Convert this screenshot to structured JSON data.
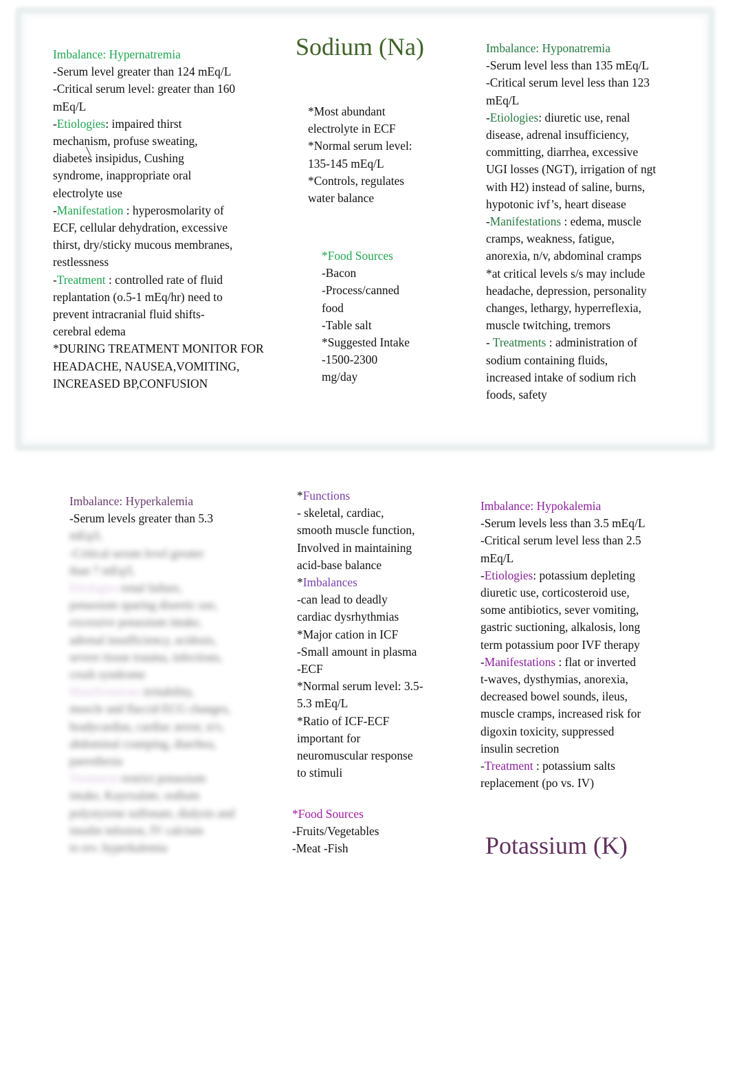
{
  "sodium": {
    "title": "Sodium (Na)",
    "hypernatremia": {
      "heading": "Imbalance: Hypernatremia",
      "lines": [
        "-Serum level greater than 124 mEq/L",
        "-Critical serum level: greater than 160",
        "mEq/L"
      ],
      "etiologies_label": "Etiologies",
      "etiologies_lines": [
        ": impaired thirst",
        "mechanism, profuse sweating,",
        "diabetes insipidus, Cushing",
        "syndrome, inappropriate oral",
        "electrolyte use"
      ],
      "manifestation_label": "Manifestation",
      "manifestation_lines": [
        " : hyperosmolarity of",
        "ECF, cellular dehydration, excessive",
        "thirst, dry/sticky mucous membranes,",
        "restlessness"
      ],
      "treatment_label": "Treatment",
      "treatment_lines": [
        " : controlled rate of fluid",
        "replantation (o.5-1 mEq/hr) need to",
        "prevent intracranial fluid shifts-",
        "cerebral edema",
        "*DURING TREATMENT MONITOR FOR",
        "HEADACHE, NAUSEA,VOMITING,",
        "INCREASED BP,CONFUSION"
      ]
    },
    "center": {
      "facts": [
        "*Most abundant",
        "electrolyte in ECF",
        "*Normal serum level:",
        "135-145 mEq/L",
        "*Controls, regulates",
        "water balance"
      ],
      "food_heading": "*Food Sources",
      "food_lines": [
        "-Bacon",
        "-Process/canned",
        "food",
        "-Table salt",
        "*Suggested Intake",
        "-1500-2300",
        "mg/day"
      ]
    },
    "hyponatremia": {
      "heading": "Imbalance: Hyponatremia",
      "lines": [
        "-Serum level less than 135 mEq/L",
        "-Critical serum level less than 123",
        "mEq/L"
      ],
      "etiologies_label": "Etiologies",
      "etiologies_lines": [
        ": diuretic use, renal",
        "disease, adrenal insufficiency,",
        "committing, diarrhea, excessive",
        "UGI losses (NGT), irrigation of ngt",
        "with H2) instead of saline, burns,",
        "hypotonic ivf’s, heart disease"
      ],
      "manifestations_label": "Manifestations",
      "manifestations_lines": [
        " : edema, muscle",
        "cramps, weakness, fatigue,",
        "anorexia, n/v, abdominal cramps",
        "*at critical levels s/s may include",
        "headache, depression, personality",
        "changes, lethargy, hyperreflexia,",
        "muscle twitching, tremors"
      ],
      "treatments_label": "Treatments",
      "treatments_lines": [
        " : administration of",
        "sodium containing fluids,",
        "increased intake of sodium rich",
        "foods, safety"
      ]
    }
  },
  "potassium": {
    "title": "Potassium (K)",
    "hyperkalemia": {
      "heading": "Imbalance: Hyperkalemia",
      "lines": [
        "-Serum levels greater than 5.3"
      ],
      "blurred_lines": [
        "mEq/L",
        "-Critical serum level greater",
        "than 7 mEq/L",
        "renal failure,",
        "potassium sparing diuretic use,",
        "excessive potassium intake,",
        "adrenal insufficiency, acidosis,",
        "severe tissue trauma, infections,",
        "crush syndrome",
        "irritability,",
        "muscle and flaccid ECG changes,",
        "bradycardias, cardiac arrest, n/v,",
        "abdominal cramping, diarrhea,",
        "paresthesia",
        "restrict potassium",
        "intake, Kayexalate, sodium",
        "polystyrene sulfonate, dialysis and",
        "insulin infusion, IV calcium",
        "to rev. hyperkalemia"
      ],
      "blurred_highlights": [
        "Etiologies",
        "Manifestations",
        "Treatment"
      ]
    },
    "center": {
      "functions_heading": "Functions",
      "functions_lines": [
        "- skeletal, cardiac,",
        "smooth muscle function,",
        "Involved in maintaining",
        "acid-base balance"
      ],
      "imbalances_heading": "Imbalances",
      "imbalances_lines": [
        "-can lead to deadly",
        "cardiac dysrhythmias",
        "*Major cation in ICF",
        "-Small amount in plasma",
        "-ECF",
        "*Normal serum level: 3.5-",
        "5.3 mEq/L",
        "*Ratio of ICF-ECF",
        "important for",
        "neuromuscular response",
        "to stimuli"
      ],
      "food_heading": "*Food Sources",
      "food_lines": [
        "-Fruits/Vegetables",
        "-Meat -Fish"
      ]
    },
    "hypokalemia": {
      "heading": "Imbalance: Hypokalemia",
      "lines": [
        "-Serum levels less than 3.5 mEq/L",
        "-Critical serum level less than 2.5",
        "mEq/L"
      ],
      "etiologies_label": "Etiologies",
      "etiologies_lines": [
        ": potassium depleting",
        "diuretic use, corticosteroid use,",
        "some antibiotics, sever vomiting,",
        "gastric suctioning, alkalosis, long",
        "term potassium poor IVF therapy"
      ],
      "manifestations_label": "Manifestations",
      "manifestations_lines": [
        " : flat or inverted",
        "t-waves, dysthymias, anorexia,",
        "decreased bowel sounds, ileus,",
        "muscle cramps, increased risk for",
        "digoxin toxicity, suppressed",
        "insulin secretion"
      ],
      "treatment_label": "Treatment",
      "treatment_lines": [
        " : potassium salts",
        "replacement (po vs. IV)"
      ]
    }
  },
  "colors": {
    "sodium_accent": "#1ea650",
    "sodium_accent_dark": "#257a40",
    "sodium_title": "#3f6328",
    "potassium_title": "#60305e",
    "potassium_accent": "#8e1f9e",
    "frame": "#e9eeee"
  }
}
